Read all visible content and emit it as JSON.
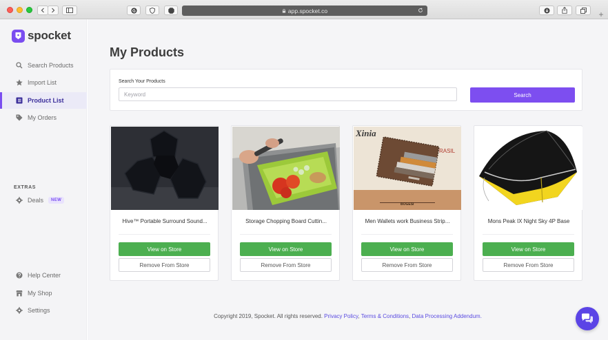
{
  "browser": {
    "url": "app.spocket.co",
    "plus_label": "+"
  },
  "sidebar": {
    "logo_text": "spocket",
    "nav": [
      {
        "label": "Search Products",
        "icon": "search-icon"
      },
      {
        "label": "Import List",
        "icon": "star-icon"
      },
      {
        "label": "Product List",
        "icon": "list-icon",
        "active": true
      },
      {
        "label": "My Orders",
        "icon": "tag-icon"
      }
    ],
    "extras_label": "EXTRAS",
    "deals": {
      "label": "Deals",
      "badge": "NEW",
      "icon": "gear-icon"
    },
    "bottom": [
      {
        "label": "Help Center",
        "icon": "help-icon"
      },
      {
        "label": "My Shop",
        "icon": "shop-icon"
      },
      {
        "label": "Settings",
        "icon": "gear-icon"
      }
    ]
  },
  "main": {
    "title": "My Products",
    "search": {
      "label": "Search Your Products",
      "placeholder": "Keyword",
      "button": "Search"
    },
    "products": [
      {
        "title": "Hive™ Portable Surround Sound...",
        "view": "View on Store",
        "remove": "Remove From Store"
      },
      {
        "title": "Storage Chopping Board Cuttin...",
        "view": "View on Store",
        "remove": "Remove From Store"
      },
      {
        "title": "Men Wallets work Business Strip...",
        "view": "View on Store",
        "remove": "Remove From Store"
      },
      {
        "title": "Mons Peak IX Night Sky 4P Base",
        "view": "View on Store",
        "remove": "Remove From Store"
      }
    ],
    "product_images": {
      "wallet_brand_top": "Xinia",
      "wallet_brand_right": "RASIL",
      "wallet_brand_bottom": "BOGESI"
    },
    "footer": {
      "copyright": "Copyright 2019, Spocket. All rights reserved.",
      "privacy": "Privacy Policy",
      "sep1": ",",
      "terms": "Terms & Conditions",
      "sep2": ",",
      "dpa": "Data Processing Addendum."
    }
  },
  "colors": {
    "brand": "#7a4df0",
    "success": "#4caf50",
    "chat": "#5b44e6"
  }
}
